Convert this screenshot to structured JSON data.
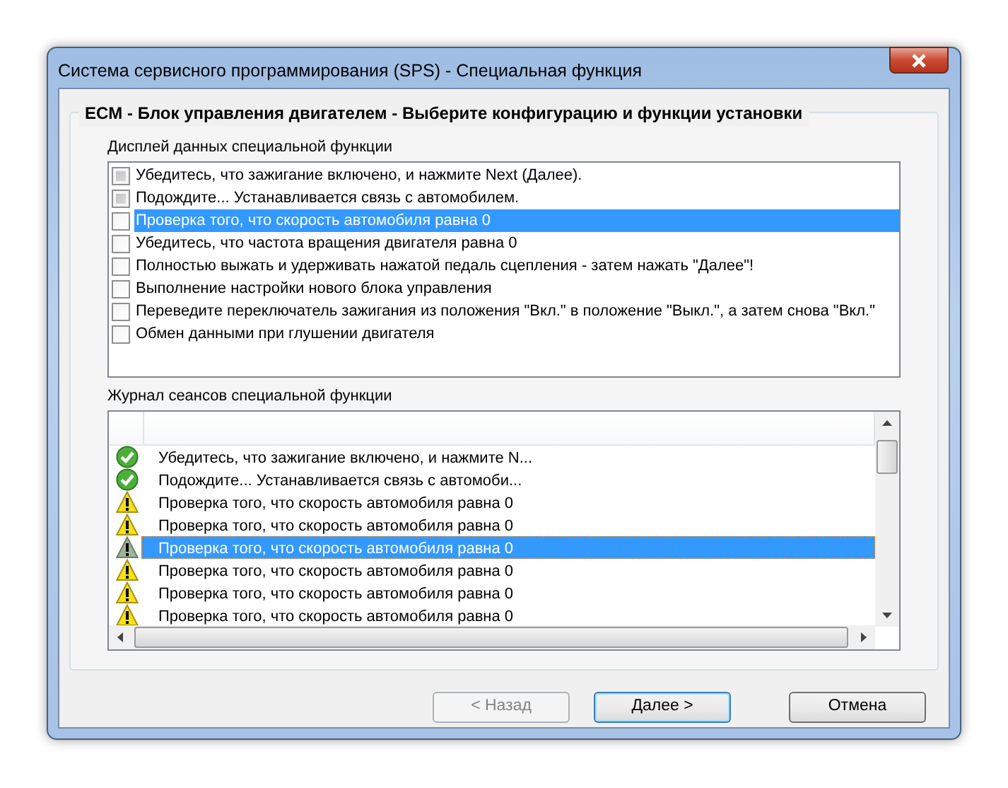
{
  "window": {
    "title": "Система сервисного программирования (SPS) - Специальная функция"
  },
  "group_title": "ECM - Блок управления двигателем - Выберите конфигурацию и функции установки",
  "display": {
    "label": "Дисплей данных специальной функции",
    "items": [
      {
        "text": "Убедитесь, что зажигание включено, и нажмите Next (Далее).",
        "completed": true,
        "selected": false
      },
      {
        "text": "Подождите... Устанавливается связь с автомобилем.",
        "completed": true,
        "selected": false
      },
      {
        "text": "Проверка того, что скорость автомобиля равна 0",
        "completed": false,
        "selected": true
      },
      {
        "text": "Убедитесь, что частота вращения двигателя равна 0",
        "completed": false,
        "selected": false
      },
      {
        "text": "Полностью выжать и удерживать нажатой педаль сцепления - затем нажать \"Далее\"!",
        "completed": false,
        "selected": false
      },
      {
        "text": "Выполнение настройки нового блока управления",
        "completed": false,
        "selected": false
      },
      {
        "text": "Переведите переключатель зажигания из положения \"Вкл.\" в положение \"Выкл.\", а затем снова \"Вкл.\"",
        "completed": false,
        "selected": false
      },
      {
        "text": "Обмен данными при глушении двигателя",
        "completed": false,
        "selected": false
      }
    ]
  },
  "log": {
    "label": "Журнал сеансов специальной функции",
    "rows": [
      {
        "kind": "ok",
        "text": "Убедитесь, что зажигание включено, и нажмите N...",
        "selected": false
      },
      {
        "kind": "ok",
        "text": "Подождите... Устанавливается связь с автомоби...",
        "selected": false
      },
      {
        "kind": "warning",
        "text": "Проверка того, что скорость автомобиля равна 0",
        "selected": false
      },
      {
        "kind": "warning",
        "text": "Проверка того, что скорость автомобиля равна 0",
        "selected": false
      },
      {
        "kind": "warning",
        "text": "Проверка того, что скорость автомобиля равна 0",
        "selected": true
      },
      {
        "kind": "warning",
        "text": "Проверка того, что скорость автомобиля равна 0",
        "selected": false
      },
      {
        "kind": "warning",
        "text": "Проверка того, что скорость автомобиля равна 0",
        "selected": false
      },
      {
        "kind": "warning",
        "text": "Проверка того, что скорость автомобиля равна 0",
        "selected": false
      }
    ]
  },
  "buttons": [
    {
      "label": "< Назад",
      "disabled": true,
      "default": false
    },
    {
      "label": "Далее >",
      "disabled": false,
      "default": true
    },
    {
      "label": "Отмена",
      "disabled": false,
      "default": false
    }
  ]
}
